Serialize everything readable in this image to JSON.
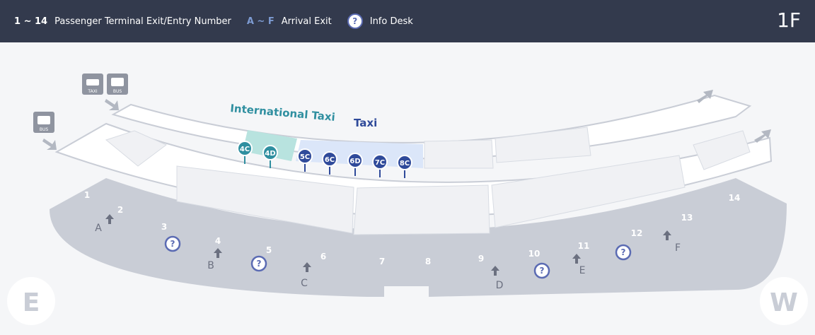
{
  "header": {
    "exit_range": "1 ~ 14",
    "exit_label": "Passenger Terminal Exit/Entry Number",
    "arrival_range": "A ~ F",
    "arrival_label": "Arrival Exit",
    "info_label": "Info Desk",
    "floor": "1F"
  },
  "map": {
    "taxi_sign": "TAXI",
    "bus_sign": "BUS",
    "international_taxi_label": "International Taxi",
    "taxi_label": "Taxi",
    "bus_stops": [
      "4C",
      "4D",
      "5C",
      "6C",
      "6D",
      "7C",
      "8C"
    ],
    "exits": [
      "1",
      "2",
      "3",
      "4",
      "5",
      "6",
      "7",
      "8",
      "9",
      "10",
      "11",
      "12",
      "13",
      "14"
    ],
    "arrival_exits": [
      "A",
      "B",
      "C",
      "D",
      "E",
      "F"
    ],
    "compass_east": "E",
    "compass_west": "W",
    "colors": {
      "international_taxi": "#2f8fa0",
      "taxi": "#2f4a9a",
      "header_bg": "#333a4d",
      "info_desk": "#5b6bb3"
    }
  }
}
